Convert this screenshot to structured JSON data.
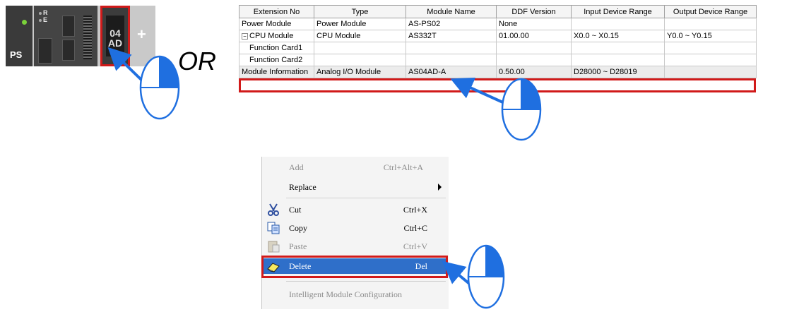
{
  "plc": {
    "ps_label": "PS",
    "cpu_led_r": "R",
    "cpu_led_e": "E",
    "module_line1": "04",
    "module_line2": "AD",
    "add_symbol": "+"
  },
  "or_text": "OR",
  "table": {
    "headers": [
      "Extension No",
      "Type",
      "Module Name",
      "DDF Version",
      "Input Device Range",
      "Output Device Range"
    ],
    "rows": [
      {
        "ext": "Power Module",
        "type": "Power Module",
        "name": "AS-PS02",
        "ddf": "None",
        "input": "",
        "output": ""
      },
      {
        "ext": "CPU Module",
        "type": "CPU Module",
        "name": "AS332T",
        "ddf": "01.00.00",
        "input": "X0.0 ~ X0.15",
        "output": "Y0.0 ~ Y0.15"
      },
      {
        "ext": "Function Card1",
        "type": "",
        "name": "",
        "ddf": "",
        "input": "",
        "output": ""
      },
      {
        "ext": "Function Card2",
        "type": "",
        "name": "",
        "ddf": "",
        "input": "",
        "output": ""
      },
      {
        "ext": "Module Information",
        "type": "Analog I/O Module",
        "name": "AS04AD-A",
        "ddf": "0.50.00",
        "input": "D28000 ~ D28019",
        "output": ""
      }
    ]
  },
  "context_menu": {
    "items": [
      {
        "label": "Add",
        "shortcut": "Ctrl+Alt+A",
        "enabled": false,
        "icon": ""
      },
      {
        "label": "Replace",
        "shortcut": "",
        "enabled": true,
        "icon": "submenu-arrow"
      },
      {
        "label": "Cut",
        "shortcut": "Ctrl+X",
        "enabled": true,
        "icon": "scissors-icon"
      },
      {
        "label": "Copy",
        "shortcut": "Ctrl+C",
        "enabled": true,
        "icon": "copy-icon"
      },
      {
        "label": "Paste",
        "shortcut": "Ctrl+V",
        "enabled": false,
        "icon": "paste-icon"
      },
      {
        "label": "Delete",
        "shortcut": "Del",
        "enabled": true,
        "highlighted": true,
        "icon": "eraser-icon"
      },
      {
        "label": "Intelligent Module Configuration",
        "shortcut": "",
        "enabled": false,
        "icon": ""
      }
    ]
  },
  "colors": {
    "highlight_border": "#d11a1a",
    "menu_highlight": "#2f6fc9",
    "mouse_blue": "#1f6fe0",
    "arrow_blue": "#1f6fe0"
  }
}
